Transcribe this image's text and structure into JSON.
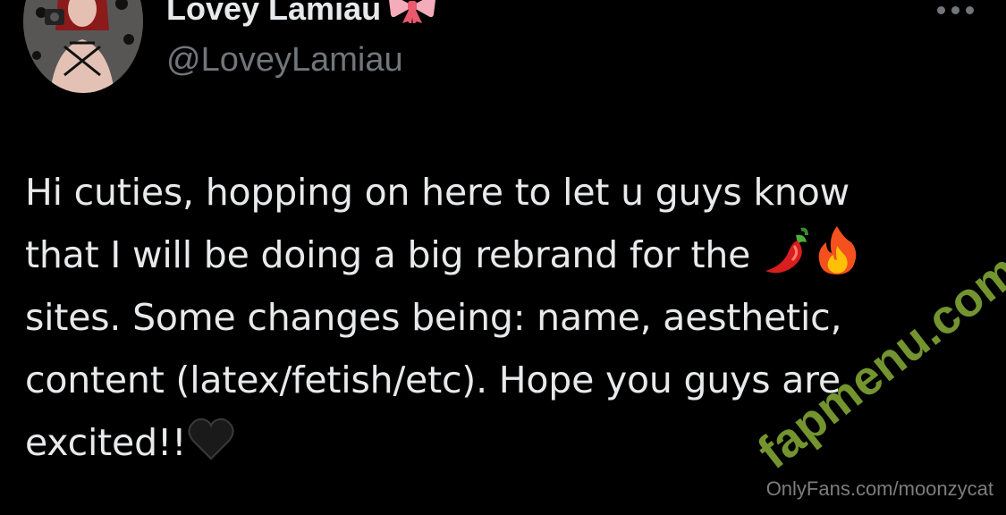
{
  "author": {
    "display_name": "Lovey Lamiau",
    "handle": "@LoveyLamiau",
    "name_emoji_icon": "ribbon-bow-icon"
  },
  "tweet": {
    "lines": [
      "Hi cuties, hopping on here to let u guys know",
      "that I will be doing a big rebrand for the",
      "sites. Some changes being: name, aesthetic,",
      "content (latex/fetish/etc). Hope you guys are",
      "excited!!"
    ],
    "emoji_icons": [
      "hot-pepper-icon",
      "fire-icon",
      "black-heart-icon"
    ]
  },
  "watermark": {
    "text": "fapmenu.com"
  },
  "source_caption": "OnlyFans.com/moonzycat",
  "colors": {
    "background": "#000000",
    "text_primary": "#e7e9ea",
    "text_secondary": "#71767b",
    "watermark_green": "#94be3c"
  }
}
